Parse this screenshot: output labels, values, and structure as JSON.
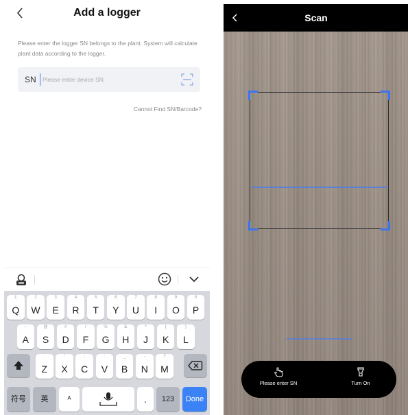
{
  "left_screen": {
    "header": {
      "back_icon": "chevron-left-icon",
      "title": "Add a logger"
    },
    "description": "Please enter the logger SN belongs to the plant. System will calculate plant data according to the logger.",
    "sn_field": {
      "label": "SN",
      "value": "",
      "placeholder": "Please enter device SN",
      "scan_icon": "scan-icon"
    },
    "cannot_find_link": "Cannot Find SN/Barcode?",
    "keyboard": {
      "toolbar": {
        "left_icon": "keyboard-tools-icon",
        "emoji_icon": "emoji-icon",
        "collapse_icon": "chevron-down-icon"
      },
      "row1": [
        {
          "hint": "1",
          "key": "Q"
        },
        {
          "hint": "2",
          "key": "W"
        },
        {
          "hint": "3",
          "key": "E"
        },
        {
          "hint": "4",
          "key": "R"
        },
        {
          "hint": "5",
          "key": "T"
        },
        {
          "hint": "6",
          "key": "Y"
        },
        {
          "hint": "7",
          "key": "U"
        },
        {
          "hint": "8",
          "key": "I"
        },
        {
          "hint": "9",
          "key": "O"
        },
        {
          "hint": "0",
          "key": "P"
        }
      ],
      "row2": [
        {
          "hint": "~",
          "key": "A"
        },
        {
          "hint": "@",
          "key": "S"
        },
        {
          "hint": "#",
          "key": "D"
        },
        {
          "hint": "/",
          "key": "F"
        },
        {
          "hint": "%",
          "key": "G"
        },
        {
          "hint": "&",
          "key": "H"
        },
        {
          "hint": "*",
          "key": "J"
        },
        {
          "hint": "(",
          "key": "K"
        },
        {
          "hint": ")",
          "key": "L"
        }
      ],
      "row3": [
        {
          "hint": "'",
          "key": "Z"
        },
        {
          "hint": "\"",
          "key": "X"
        },
        {
          "hint": ";",
          "key": "C"
        },
        {
          "hint": ":",
          "key": "V"
        },
        {
          "hint": "_",
          "key": "B"
        },
        {
          "hint": "-",
          "key": "N"
        },
        {
          "hint": "?",
          "key": "M"
        }
      ],
      "shift_icon": "shift-icon",
      "backspace_icon": "backspace-icon",
      "bottom": {
        "symbols": "符号",
        "lang": "英",
        "punct": "ᴬ",
        "space_icon": "microphone-icon",
        "dot": ".",
        "numbers": "123",
        "done": "Done"
      }
    }
  },
  "right_screen": {
    "header": {
      "back_icon": "chevron-left-icon",
      "title": "Scan"
    },
    "bottom_bar": {
      "enter_sn": {
        "icon": "hand-tap-icon",
        "label": "Please enter SN"
      },
      "flashlight": {
        "icon": "flashlight-icon",
        "label": "Turn On"
      }
    }
  },
  "colors": {
    "accent": "#3b74f0",
    "done_key": "#3b82f6",
    "keyboard_bg": "#d6d8dd",
    "scan_bar": "#000000"
  }
}
